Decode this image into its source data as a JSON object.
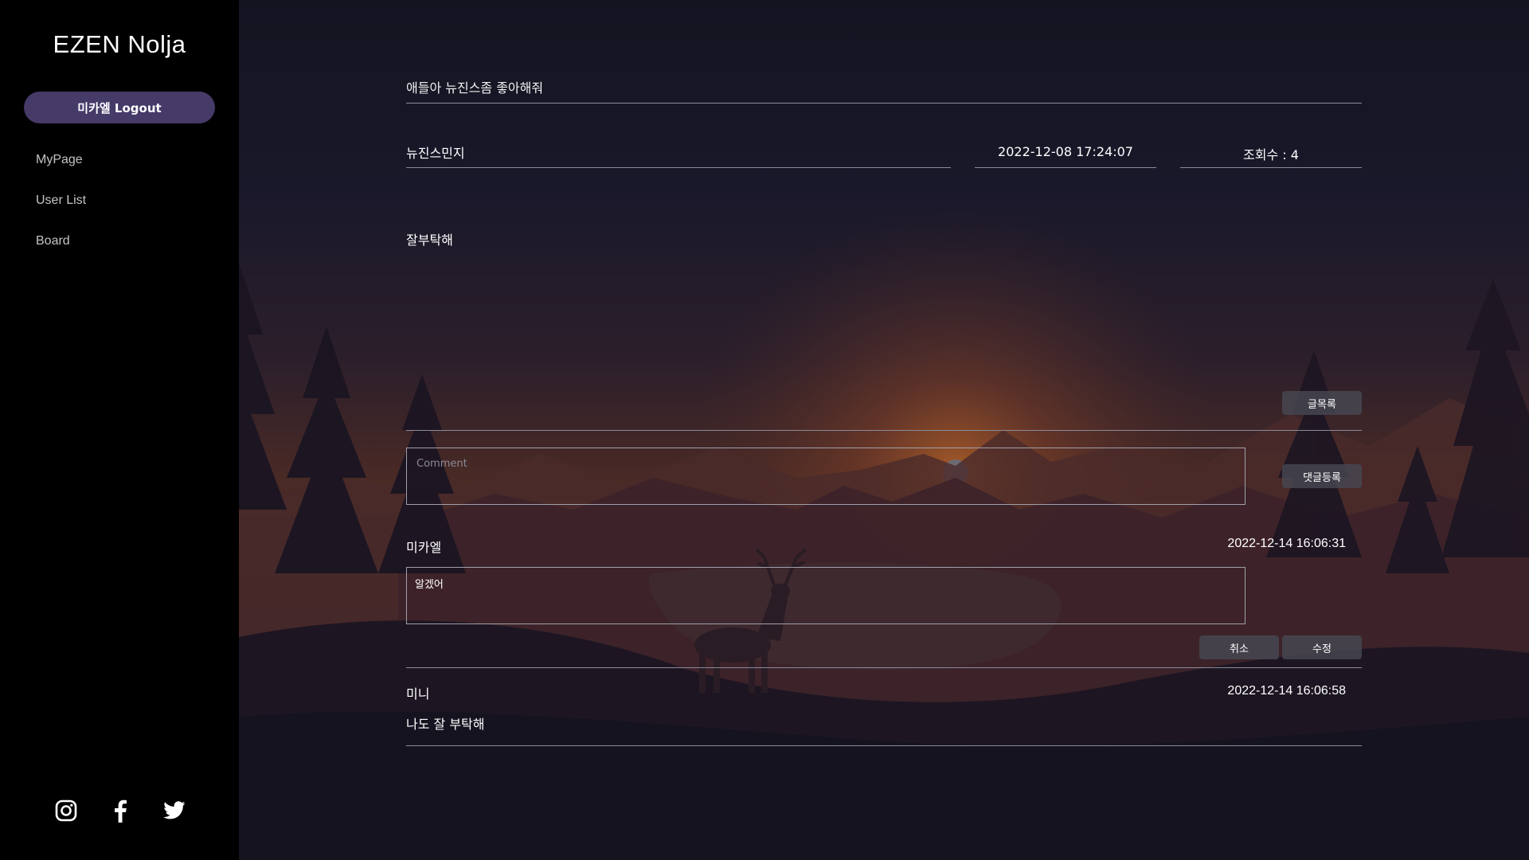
{
  "sidebar": {
    "brand": "EZEN Nolja",
    "logout_label": "미카엘 Logout",
    "nav": [
      {
        "label": "MyPage"
      },
      {
        "label": "User List"
      },
      {
        "label": "Board"
      }
    ],
    "social_icons": [
      "instagram-icon",
      "facebook-icon",
      "twitter-icon"
    ]
  },
  "post": {
    "title": "애들아 뉴진스좀 좋아해줘",
    "author": "뉴진스민지",
    "date": "2022-12-08 17:24:07",
    "views": "조회수 : 4",
    "content": "잘부탁해",
    "list_button": "글목록"
  },
  "comment_form": {
    "placeholder": "Comment",
    "submit_label": "댓글등록"
  },
  "comments": [
    {
      "author": "미카엘",
      "date": "2022-12-14 16:06:31",
      "text": "알겠어",
      "editing": true,
      "cancel_label": "취소",
      "edit_label": "수정"
    },
    {
      "author": "미니",
      "date": "2022-12-14 16:06:58",
      "text": "나도 잘 부탁해"
    }
  ],
  "colors": {
    "sidebar_bg": "#000000",
    "accent": "#453a68",
    "page_bg": "#141421"
  }
}
